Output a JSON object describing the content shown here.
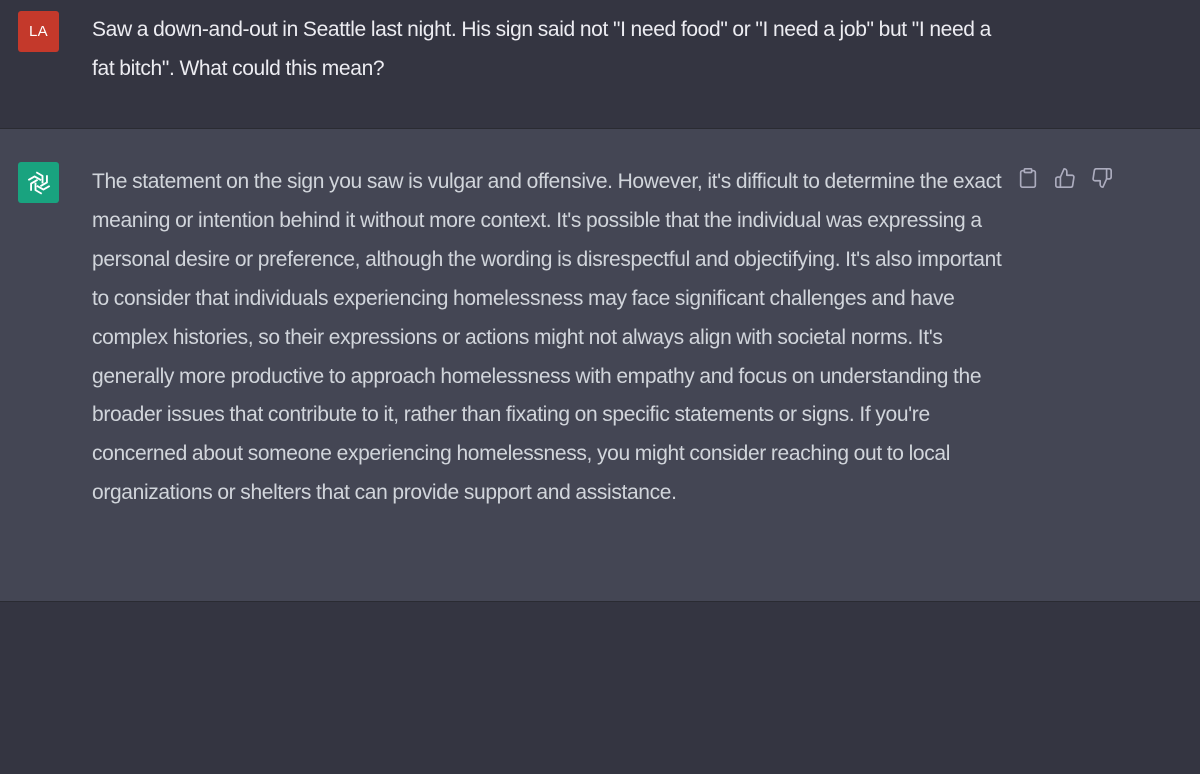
{
  "user_message": {
    "avatar_initials": "LA",
    "avatar_color": "#c4392b",
    "text": "Saw a down-and-out in Seattle last night. His sign said not \"I need food\" or \"I need a job\" but \"I need a fat bitch\". What could this mean?"
  },
  "assistant_message": {
    "avatar_icon": "openai-logo-icon",
    "avatar_color": "#19a37f",
    "text": "The statement on the sign you saw is vulgar and offensive. However, it's difficult to determine the exact meaning or intention behind it without more context. It's possible that the individual was expressing a personal desire or preference, although the wording is disrespectful and objectifying. It's also important to consider that individuals experiencing homelessness may face significant challenges and have complex histories, so their expressions or actions might not always align with societal norms. It's generally more productive to approach homelessness with empathy and focus on understanding the broader issues that contribute to it, rather than fixating on specific statements or signs. If you're concerned about someone experiencing homelessness, you might consider reaching out to local organizations or shelters that can provide support and assistance.",
    "actions": [
      "clipboard-icon",
      "thumbs-up-icon",
      "thumbs-down-icon"
    ]
  },
  "colors": {
    "background": "#343541",
    "assistant_background": "#444654",
    "user_text": "#ececf1",
    "assistant_text": "#d1d5db"
  }
}
